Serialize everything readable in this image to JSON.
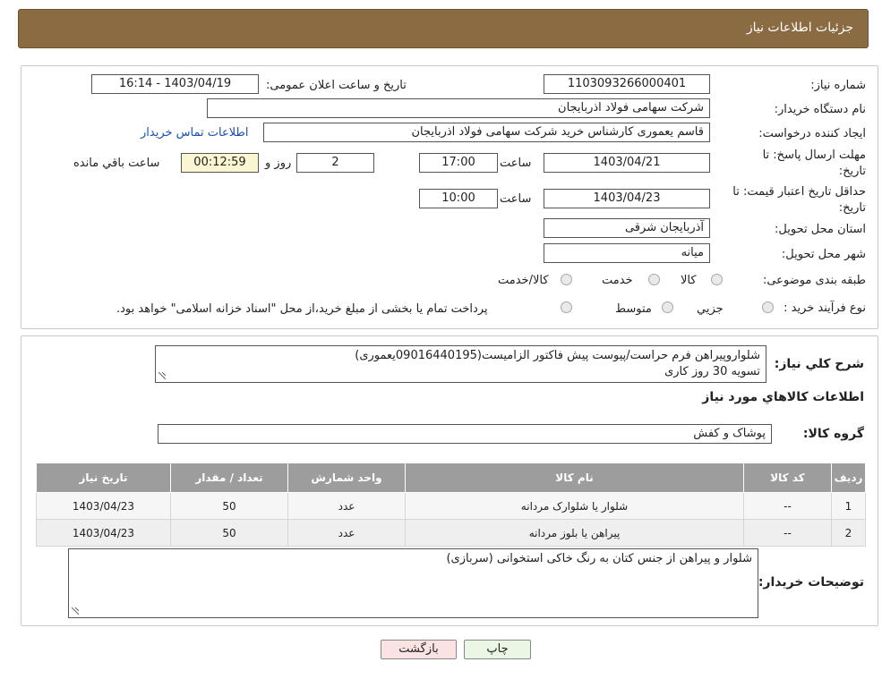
{
  "header": {
    "title": "جزئیات اطلاعات نیاز"
  },
  "form": {
    "need_number_label": "شماره نیاز:",
    "need_number": "1103093266000401",
    "announce_label": "تاریخ و ساعت اعلان عمومی:",
    "announce_value": "1403/04/19 - 16:14",
    "buyer_label": "نام دستگاه خریدار:",
    "buyer_value": "شرکت سهامی فولاد اذربایجان",
    "creator_label": "ایجاد کننده درخواست:",
    "creator_value": "قاسم یعموری کارشناس خرید شرکت سهامی فولاد اذربایجان",
    "contact_link": "اطلاعات تماس خریدار",
    "deadline_label_1": "مهلت ارسال پاسخ: تا",
    "deadline_label_2": "تاریخ:",
    "deadline_date": "1403/04/21",
    "time_label": "ساعت",
    "deadline_time": "17:00",
    "days_value": "2",
    "days_label": "روز و",
    "remaining_value": "00:12:59",
    "remaining_label": "ساعت باقي مانده",
    "validity_label_1": "حداقل تاريخ اعتبار قيمت: تا",
    "validity_label_2": "تاريخ:",
    "validity_date": "1403/04/23",
    "validity_time": "10:00",
    "province_label": "استان محل تحویل:",
    "province_value": "آذربایجان شرقی",
    "city_label": "شهر محل تحویل:",
    "city_value": "میانه",
    "category_label": "طبقه بندی موضوعی:",
    "category_options": [
      "کالا",
      "خدمت",
      "کالا/خدمت"
    ],
    "process_label": "نوع فرآیند خرید :",
    "process_options": [
      "جزيي",
      "متوسط"
    ],
    "process_note": "پرداخت تمام یا بخشی از مبلغ خرید،از محل \"اسناد خزانه اسلامی\" خواهد بود."
  },
  "description": {
    "label": "شرح کلي نياز:",
    "line1": "شلواروپیراهن فرم حراست/پیوست پیش فاکتور الزامیست(09016440195یعموری)",
    "line2": "تسویه 30 روز کاری"
  },
  "goods": {
    "section_title": "اطلاعات کالاهاي مورد نياز",
    "group_label": "گروه کالا:",
    "group_value": "پوشاک و کفش",
    "columns": [
      "رديف",
      "کد کالا",
      "نام کالا",
      "واحد شمارش",
      "تعداد / مقدار",
      "تاريخ نياز"
    ],
    "rows": [
      [
        "1",
        "--",
        "شلوار یا شلوارک مردانه",
        "عدد",
        "50",
        "1403/04/23"
      ],
      [
        "2",
        "--",
        "پیراهن یا بلوز مردانه",
        "عدد",
        "50",
        "1403/04/23"
      ]
    ]
  },
  "buyer_notes": {
    "label": "توضیحات خریدار:",
    "value": "شلوار و پیراهن از جنس کتان به رنگ خاکی استخوانی (سربازی)"
  },
  "buttons": {
    "print": "چاپ",
    "back": "بازگشت"
  },
  "colors": {
    "header": "#8b6b42",
    "table_header": "#9d9d9d",
    "print_btn": "#eaf7e4",
    "back_btn": "#fbe3e3"
  }
}
